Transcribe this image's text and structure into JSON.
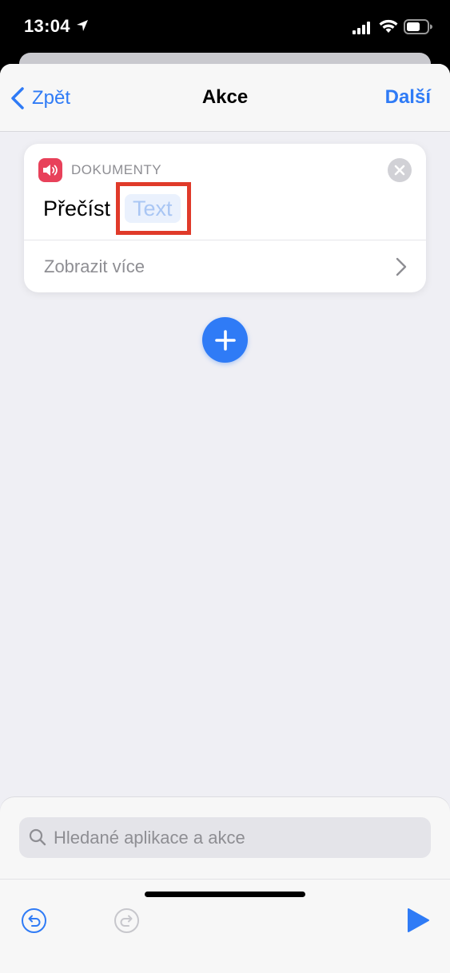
{
  "status_bar": {
    "time": "13:04",
    "icons": [
      "location-arrow-icon",
      "signal-icon",
      "wifi-icon",
      "battery-icon"
    ]
  },
  "nav": {
    "back_label": "Zpět",
    "title": "Akce",
    "next_label": "Další"
  },
  "action_card": {
    "app_icon": "speaker-icon",
    "category": "DOKUMENTY",
    "verb": "Přečíst",
    "token": "Text",
    "show_more_label": "Zobrazit více"
  },
  "bottom_panel": {
    "search_placeholder": "Hledané aplikace a akce",
    "undo_icon": "undo-icon",
    "redo_icon": "redo-icon",
    "run_icon": "play-icon"
  },
  "colors": {
    "accent": "#2f7bf6",
    "app_icon_bg": "#e8415a",
    "highlight": "#e03a2a"
  }
}
